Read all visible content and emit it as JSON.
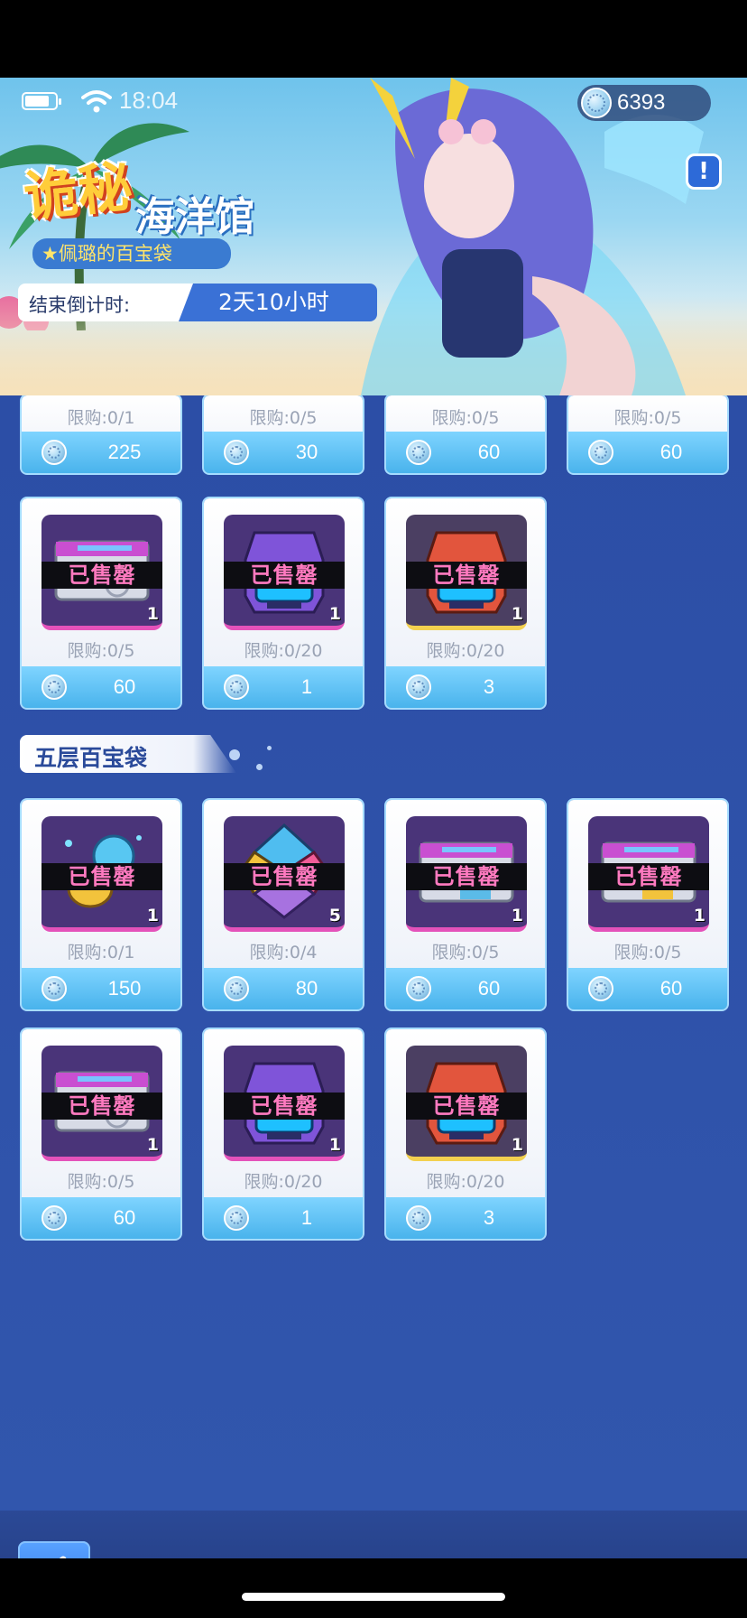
{
  "status_bar": {
    "time": "18:04"
  },
  "currency": {
    "icon": "coin-icon",
    "amount": "6393"
  },
  "banner": {
    "event_title_main": "诡秘",
    "event_title_sub": "海洋馆",
    "event_subtitle": "★佩璐的百宝袋",
    "info_icon": "info-icon",
    "countdown_label": "结束倒计时:",
    "countdown_value": "2天10小时"
  },
  "sold_label": "已售罄",
  "top_section_partial_items": [
    {
      "limit": "限购:0/1",
      "price": "225"
    },
    {
      "limit": "限购:0/5",
      "price": "30"
    },
    {
      "limit": "限购:0/5",
      "price": "60"
    },
    {
      "limit": "限购:0/5",
      "price": "60"
    }
  ],
  "top_section_items": [
    {
      "art": "ticket-icon",
      "count": "1",
      "limit": "限购:0/5",
      "price": "60"
    },
    {
      "art": "purple-capsule-icon",
      "count": "1",
      "limit": "限购:0/20",
      "price": "1"
    },
    {
      "art": "red-capsule-icon",
      "count": "1",
      "limit": "限购:0/20",
      "price": "3"
    }
  ],
  "fifth_section": {
    "title": "五层百宝袋",
    "items": [
      {
        "art": "gem-cluster-icon",
        "count": "1",
        "limit": "限购:0/1",
        "price": "150"
      },
      {
        "art": "crystal-icon",
        "count": "5",
        "limit": "限购:0/4",
        "price": "80"
      },
      {
        "art": "ticket-icon",
        "count": "1",
        "limit": "限购:0/5",
        "price": "60"
      },
      {
        "art": "gold-ticket-icon",
        "count": "1",
        "limit": "限购:0/5",
        "price": "60"
      },
      {
        "art": "ticket-icon",
        "count": "1",
        "limit": "限购:0/5",
        "price": "60"
      },
      {
        "art": "purple-capsule-icon",
        "count": "1",
        "limit": "限购:0/20",
        "price": "1"
      },
      {
        "art": "red-capsule-icon",
        "count": "1",
        "limit": "限购:0/20",
        "price": "3"
      }
    ]
  },
  "bottom_bar": {
    "back_icon": "back-arrow-icon"
  },
  "colors": {
    "shop_bg": "#2f52a8",
    "price_bar": "#49b3ec",
    "sold_text": "#ff7ac0",
    "accent": "#3a71d6"
  }
}
